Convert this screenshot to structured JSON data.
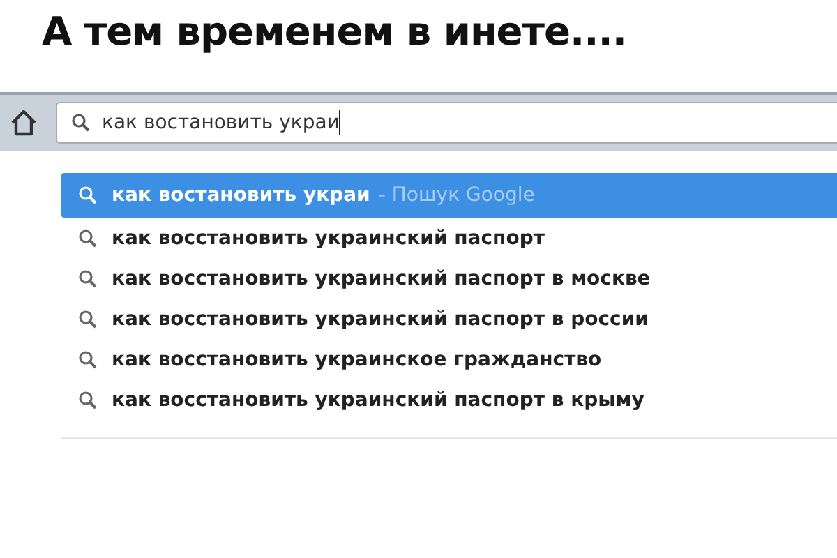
{
  "caption": "А тем временем в инете....",
  "address_bar": {
    "value": "как востановить украи"
  },
  "suggestions": [
    {
      "text": "как востановить украи",
      "source": "- Пошук Google",
      "selected": true
    },
    {
      "text": "как восстановить украинский паспорт",
      "selected": false
    },
    {
      "text": "как восстановить украинский паспорт в москве",
      "selected": false
    },
    {
      "text": "как восстановить украинский паспорт в россии",
      "selected": false
    },
    {
      "text": "как восстановить украинское гражданство",
      "selected": false
    },
    {
      "text": "как восстановить украинский паспорт в крыму",
      "selected": false
    }
  ]
}
